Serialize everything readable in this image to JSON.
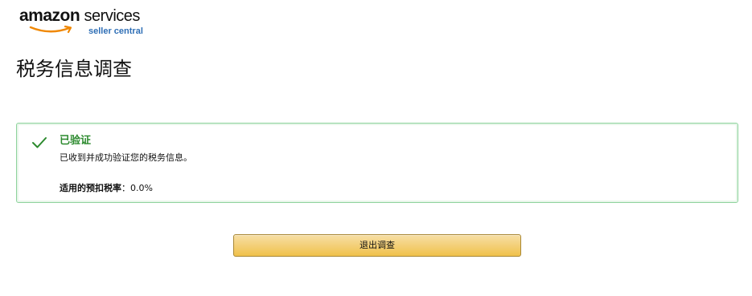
{
  "logo": {
    "brand": "amazon",
    "services": "services",
    "subtitle": "seller central",
    "smile_color": "#f08804"
  },
  "page_title": "税务信息调查",
  "alert": {
    "status": "success",
    "border_color": "#8ed39d",
    "accent_color": "#2c8a2e",
    "icon": "checkmark-icon",
    "heading": "已验证",
    "message": "已收到并成功验证您的税务信息。",
    "withholding_label": "适用的预扣税率",
    "withholding_separator": "：",
    "withholding_value": "0.0%"
  },
  "actions": {
    "exit_label": "退出调查",
    "button_color": "#f0c14b"
  }
}
